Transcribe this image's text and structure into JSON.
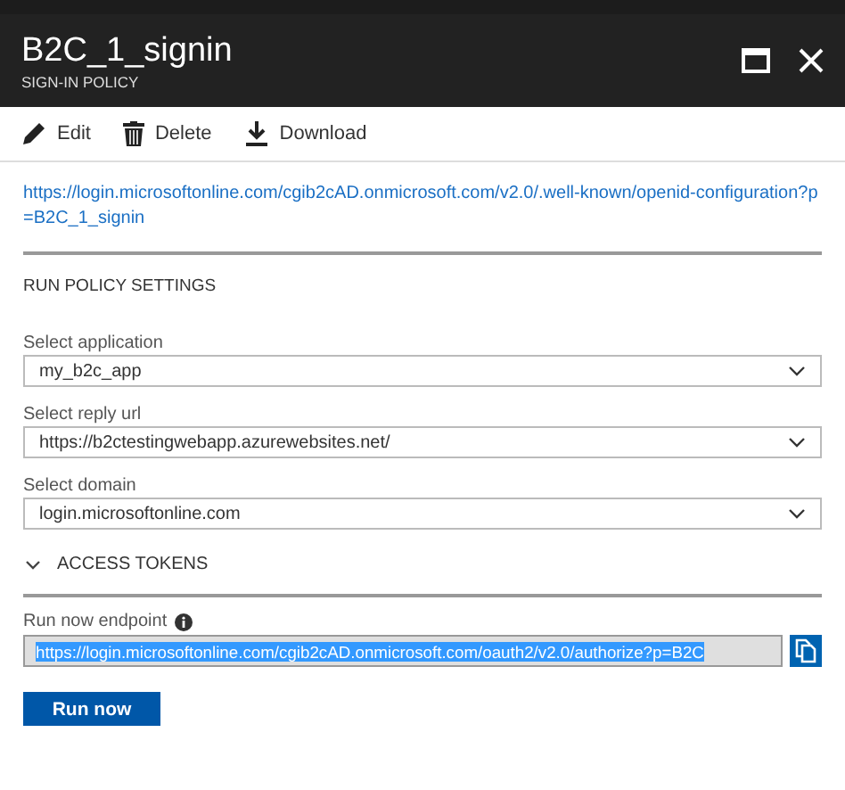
{
  "blade": {
    "title": "B2C_1_signin",
    "subtitle": "SIGN-IN POLICY"
  },
  "toolbar": [
    {
      "label": "Edit",
      "kind": "edit"
    },
    {
      "label": "Delete",
      "kind": "delete"
    },
    {
      "label": "Download",
      "kind": "download"
    }
  ],
  "metadata_link": "https://login.microsoftonline.com/cgib2cAD.onmicrosoft.com/v2.0/.well-known/openid-configuration?p=B2C_1_signin",
  "section_title": "RUN POLICY SETTINGS",
  "dropdowns": [
    {
      "label": "Select application",
      "value": "my_b2c_app"
    },
    {
      "label": "Select reply url",
      "value": "https://b2ctestingwebapp.azurewebsites.net/"
    },
    {
      "label": "Select domain",
      "value": "login.microsoftonline.com"
    }
  ],
  "access_tokens": {
    "label": "ACCESS TOKENS"
  },
  "endpoint": {
    "label": "Run now endpoint",
    "value": "https://login.microsoftonline.com/cgib2cAD.onmicrosoft.com/oauth2/v2.0/authorize?p=B2C",
    "highlighted": true
  },
  "run_button": "Run now"
}
